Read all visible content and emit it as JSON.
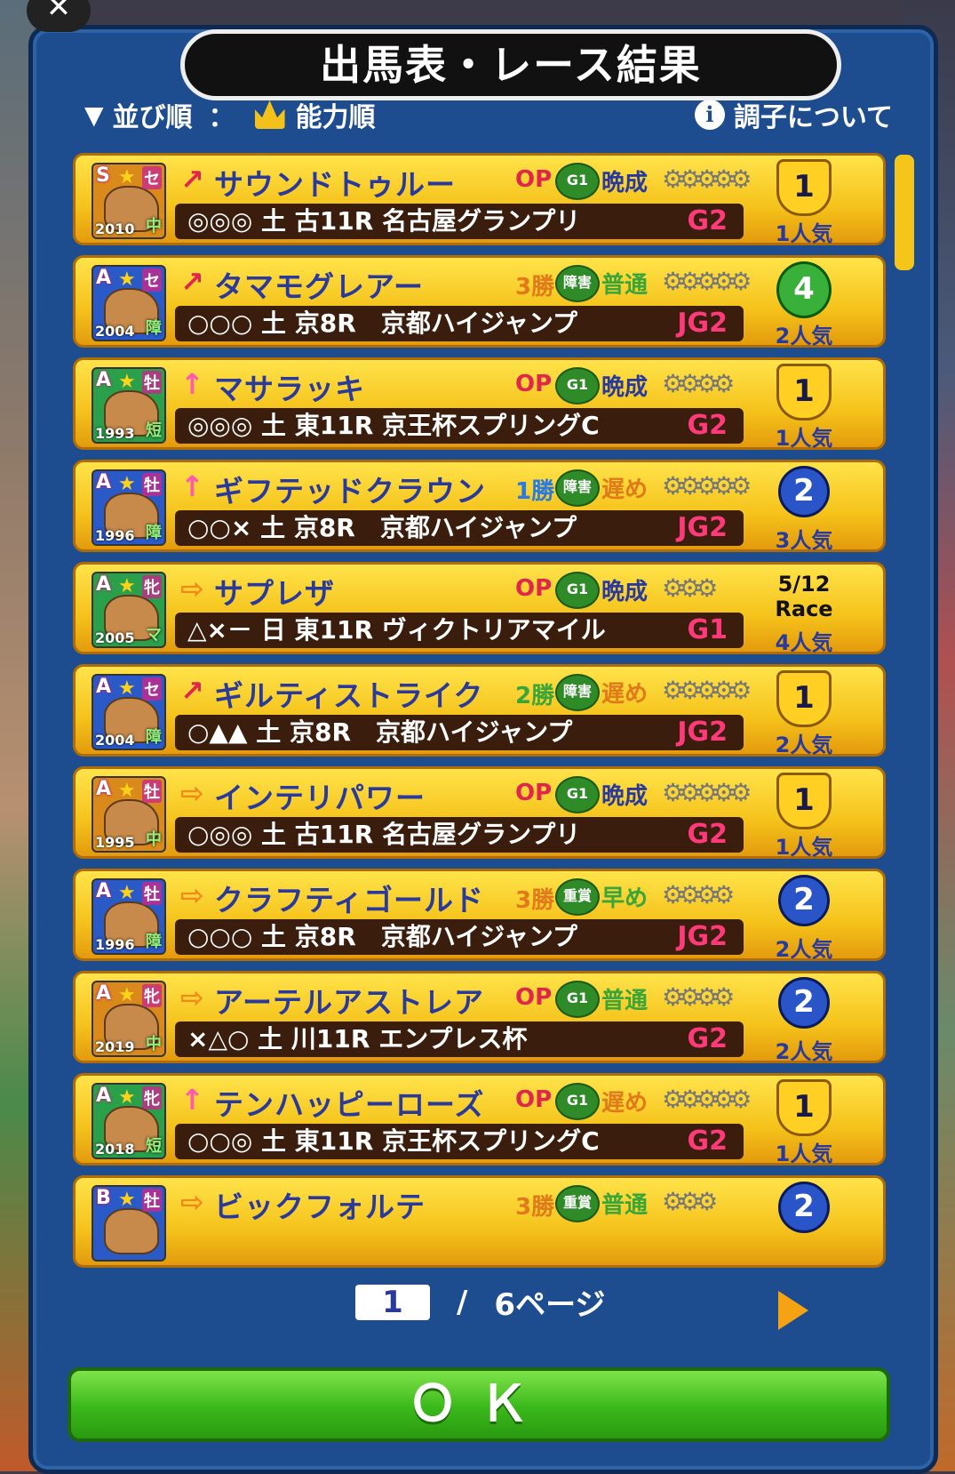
{
  "title": "出馬表・レース結果",
  "sort": {
    "label": "並び順",
    "sep": "：",
    "value": "能力順"
  },
  "condition_link": "調子について",
  "info_glyph": "i",
  "close_glyph": "✕",
  "rows": [
    {
      "rank": "S",
      "sex": "セ",
      "year": "2010",
      "apt": "中",
      "arrow": "↗",
      "arrow_color": "#e0264a",
      "name": "サウンドトゥルー",
      "cls": "OP",
      "cls_color": "#e0264a",
      "grade_badge": "G1",
      "growth": "晩成",
      "growth_color": "#2a3a9c",
      "shoes": "⚙⚙⚙⚙⚙",
      "marks": "◎◎◎ 土 古11R 名古屋グランプリ",
      "race_grade": "G2",
      "result_type": "gold",
      "result": "1",
      "pop": "1人気",
      "portrait_bg": "#d98a1a"
    },
    {
      "rank": "A",
      "sex": "セ",
      "year": "2004",
      "apt": "障",
      "arrow": "↗",
      "arrow_color": "#e0264a",
      "name": "タマモグレアー",
      "cls": "3勝",
      "cls_color": "#e07a1a",
      "grade_badge": "障害",
      "growth": "普通",
      "growth_color": "#3aa63a",
      "shoes": "⚙⚙⚙⚙⚙",
      "marks": "○○○ 土 京8R　京都ハイジャンプ",
      "race_grade": "JG2",
      "result_type": "green",
      "result": "4",
      "pop": "2人気",
      "portrait_bg": "#2a5ac8"
    },
    {
      "rank": "A",
      "sex": "牡",
      "year": "1993",
      "apt": "短",
      "arrow": "↑",
      "arrow_color": "#ff5ab0",
      "name": "マサラッキ",
      "cls": "OP",
      "cls_color": "#e0264a",
      "grade_badge": "G1",
      "growth": "晩成",
      "growth_color": "#2a3a9c",
      "shoes": "⚙⚙⚙⚙",
      "marks": "◎◎◎ 土 東11R 京王杯スプリングC",
      "race_grade": "G2",
      "result_type": "gold",
      "result": "1",
      "pop": "1人気",
      "portrait_bg": "#2aa04a"
    },
    {
      "rank": "A",
      "sex": "牡",
      "year": "1996",
      "apt": "障",
      "arrow": "↑",
      "arrow_color": "#ff5ab0",
      "name": "ギフテッドクラウン",
      "cls": "1勝",
      "cls_color": "#2a7ae0",
      "grade_badge": "障害",
      "growth": "遅め",
      "growth_color": "#e07a1a",
      "shoes": "⚙⚙⚙⚙⚙",
      "marks": "○○× 土 京8R　京都ハイジャンプ",
      "race_grade": "JG2",
      "result_type": "blue",
      "result": "2",
      "pop": "3人気",
      "portrait_bg": "#2a5ac8"
    },
    {
      "rank": "A",
      "sex": "牝",
      "year": "2005",
      "apt": "マ",
      "arrow": "⇨",
      "arrow_color": "#f08a1a",
      "name": "サプレザ",
      "cls": "OP",
      "cls_color": "#e0264a",
      "grade_badge": "G1",
      "growth": "晩成",
      "growth_color": "#2a3a9c",
      "shoes": "⚙⚙⚙",
      "marks": "△×－ 日 東11R ヴィクトリアマイル",
      "race_grade": "G1",
      "result_type": "date",
      "result": "5/12\nRace",
      "pop": "4人気",
      "portrait_bg": "#2aa04a"
    },
    {
      "rank": "A",
      "sex": "セ",
      "year": "2004",
      "apt": "障",
      "arrow": "↗",
      "arrow_color": "#e0264a",
      "name": "ギルティストライク",
      "cls": "2勝",
      "cls_color": "#3aa63a",
      "grade_badge": "障害",
      "growth": "遅め",
      "growth_color": "#e07a1a",
      "shoes": "⚙⚙⚙⚙⚙",
      "marks": "○▲▲ 土 京8R　京都ハイジャンプ",
      "race_grade": "JG2",
      "result_type": "gold",
      "result": "1",
      "pop": "2人気",
      "portrait_bg": "#2a5ac8"
    },
    {
      "rank": "A",
      "sex": "牡",
      "year": "1995",
      "apt": "中",
      "arrow": "⇨",
      "arrow_color": "#f08a1a",
      "name": "インテリパワー",
      "cls": "OP",
      "cls_color": "#e0264a",
      "grade_badge": "G1",
      "growth": "晩成",
      "growth_color": "#2a3a9c",
      "shoes": "⚙⚙⚙⚙⚙",
      "marks": "○◎◎ 土 古11R 名古屋グランプリ",
      "race_grade": "G2",
      "result_type": "gold",
      "result": "1",
      "pop": "1人気",
      "portrait_bg": "#d98a1a"
    },
    {
      "rank": "A",
      "sex": "牡",
      "year": "1996",
      "apt": "障",
      "arrow": "⇨",
      "arrow_color": "#f08a1a",
      "name": "クラフティゴールド",
      "cls": "3勝",
      "cls_color": "#e07a1a",
      "grade_badge": "重賞",
      "growth": "早め",
      "growth_color": "#3aa63a",
      "shoes": "⚙⚙⚙⚙",
      "marks": "○○○ 土 京8R　京都ハイジャンプ",
      "race_grade": "JG2",
      "result_type": "blue",
      "result": "2",
      "pop": "2人気",
      "portrait_bg": "#2a5ac8"
    },
    {
      "rank": "A",
      "sex": "牝",
      "year": "2019",
      "apt": "中",
      "arrow": "⇨",
      "arrow_color": "#f08a1a",
      "name": "アーテルアストレア",
      "cls": "OP",
      "cls_color": "#e0264a",
      "grade_badge": "G1",
      "growth": "普通",
      "growth_color": "#3aa63a",
      "shoes": "⚙⚙⚙⚙",
      "marks": "×△○ 土 川11R エンプレス杯",
      "race_grade": "G2",
      "result_type": "blue",
      "result": "2",
      "pop": "2人気",
      "portrait_bg": "#d98a1a"
    },
    {
      "rank": "A",
      "sex": "牝",
      "year": "2018",
      "apt": "短",
      "arrow": "↑",
      "arrow_color": "#ff5ab0",
      "name": "テンハッピーローズ",
      "cls": "OP",
      "cls_color": "#e0264a",
      "grade_badge": "G1",
      "growth": "遅め",
      "growth_color": "#e07a1a",
      "shoes": "⚙⚙⚙⚙⚙",
      "marks": "○○◎ 土 東11R 京王杯スプリングC",
      "race_grade": "G2",
      "result_type": "gold",
      "result": "1",
      "pop": "1人気",
      "portrait_bg": "#2aa04a"
    },
    {
      "rank": "B",
      "sex": "牡",
      "year": "",
      "apt": "",
      "arrow": "⇨",
      "arrow_color": "#f08a1a",
      "name": "ビックフォルテ",
      "cls": "3勝",
      "cls_color": "#e07a1a",
      "grade_badge": "重賞",
      "growth": "普通",
      "growth_color": "#3aa63a",
      "shoes": "⚙⚙⚙",
      "marks": "",
      "race_grade": "",
      "result_type": "blue",
      "result": "2",
      "pop": "",
      "portrait_bg": "#2a5ac8"
    }
  ],
  "pager": {
    "current": "1",
    "sep": "/",
    "total": "6ページ"
  },
  "ok_label": "ＯＫ"
}
